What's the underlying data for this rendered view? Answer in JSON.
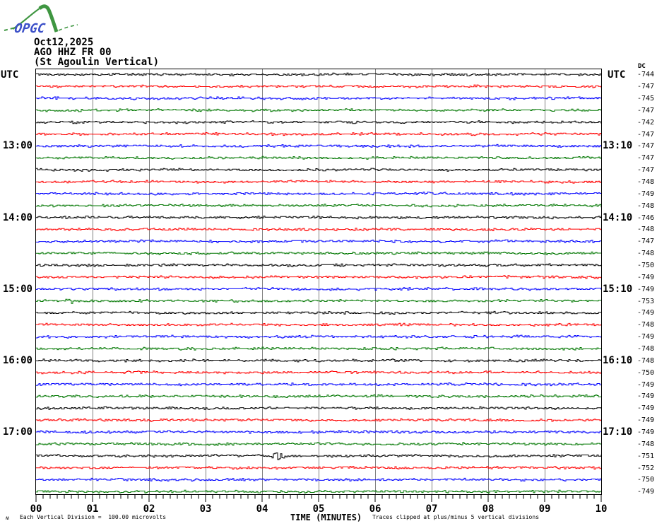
{
  "logo": {
    "name": "OPGC",
    "curve_color": "#3f9641",
    "text_color": "#3c50c8"
  },
  "header": {
    "date": "Oct12,2025",
    "station_code": "AGO HHZ FR 00",
    "station_name": "(St Agoulin Vertical)"
  },
  "axis": {
    "left_header": "UTC",
    "right_header": "UTC",
    "dc_header": "DC",
    "x_label": "TIME (MINUTES)",
    "x_tick_labels": [
      "00",
      "01",
      "02",
      "03",
      "04",
      "05",
      "06",
      "07",
      "08",
      "09",
      "10"
    ]
  },
  "left_time_labels": [
    {
      "row": 7,
      "text": "13:00"
    },
    {
      "row": 13,
      "text": "14:00"
    },
    {
      "row": 19,
      "text": "15:00"
    },
    {
      "row": 25,
      "text": "16:00"
    },
    {
      "row": 31,
      "text": "17:00"
    }
  ],
  "right_time_labels": [
    {
      "row": 7,
      "text": "13:10"
    },
    {
      "row": 13,
      "text": "14:10"
    },
    {
      "row": 19,
      "text": "15:10"
    },
    {
      "row": 25,
      "text": "16:10"
    },
    {
      "row": 31,
      "text": "17:10"
    }
  ],
  "footer": {
    "mark": "ʍ",
    "scale_note": "Each Vertical Division =  100.00 microvolts",
    "clip_note": "Traces clipped at plus/minus 5 vertical divisions"
  },
  "colors": {
    "frame": "#000000",
    "grid": "#808080",
    "text": "#000000"
  },
  "chart_data": {
    "type": "line",
    "title": "Helicorder AGO HHZ FR 00 (St Agoulin Vertical) Oct12,2025",
    "xlabel": "TIME (MINUTES)",
    "x_range_minutes": [
      0,
      10
    ],
    "x_major_tick_every_minutes": 1,
    "x_minor_ticks_per_minute": 8,
    "minutes_per_row": 10,
    "grid": "vertical-only",
    "legend": "none",
    "scale": "Each vertical division = 100.00 microvolts",
    "clipping": "Traces clipped at plus/minus 5 vertical divisions",
    "trace_color_cycle": [
      "#000000",
      "#ff0000",
      "#0000ff",
      "#007700"
    ],
    "rows": [
      {
        "color": "#000000",
        "dc": -744
      },
      {
        "color": "#ff0000",
        "dc": -747
      },
      {
        "color": "#0000ff",
        "dc": -745
      },
      {
        "color": "#007700",
        "dc": -747
      },
      {
        "color": "#000000",
        "dc": -742
      },
      {
        "color": "#ff0000",
        "dc": -747
      },
      {
        "color": "#0000ff",
        "dc": -747
      },
      {
        "color": "#007700",
        "dc": -747
      },
      {
        "color": "#000000",
        "dc": -747
      },
      {
        "color": "#ff0000",
        "dc": -748
      },
      {
        "color": "#0000ff",
        "dc": -749
      },
      {
        "color": "#007700",
        "dc": -748
      },
      {
        "color": "#000000",
        "dc": -746
      },
      {
        "color": "#ff0000",
        "dc": -748
      },
      {
        "color": "#0000ff",
        "dc": -747
      },
      {
        "color": "#007700",
        "dc": -748
      },
      {
        "color": "#000000",
        "dc": -750
      },
      {
        "color": "#ff0000",
        "dc": -749
      },
      {
        "color": "#0000ff",
        "dc": -749
      },
      {
        "color": "#007700",
        "dc": -753
      },
      {
        "color": "#000000",
        "dc": -749
      },
      {
        "color": "#ff0000",
        "dc": -748
      },
      {
        "color": "#0000ff",
        "dc": -749
      },
      {
        "color": "#007700",
        "dc": -748
      },
      {
        "color": "#000000",
        "dc": -748
      },
      {
        "color": "#ff0000",
        "dc": -750
      },
      {
        "color": "#0000ff",
        "dc": -749
      },
      {
        "color": "#007700",
        "dc": -749
      },
      {
        "color": "#000000",
        "dc": -749
      },
      {
        "color": "#ff0000",
        "dc": -749
      },
      {
        "color": "#0000ff",
        "dc": -749
      },
      {
        "color": "#007700",
        "dc": -748
      },
      {
        "color": "#000000",
        "dc": -751
      },
      {
        "color": "#ff0000",
        "dc": -752
      },
      {
        "color": "#0000ff",
        "dc": -750
      },
      {
        "color": "#007700",
        "dc": -749
      }
    ],
    "visible_events": [
      {
        "row": 5,
        "start_min": 0.55,
        "end_min": 0.85,
        "relative_amplitude": 2.5
      },
      {
        "row": 20,
        "start_min": 0.42,
        "end_min": 0.78,
        "relative_amplitude": 3.2
      },
      {
        "row": 33,
        "start_min": 4.1,
        "end_min": 4.45,
        "relative_amplitude": 7.5
      }
    ]
  }
}
